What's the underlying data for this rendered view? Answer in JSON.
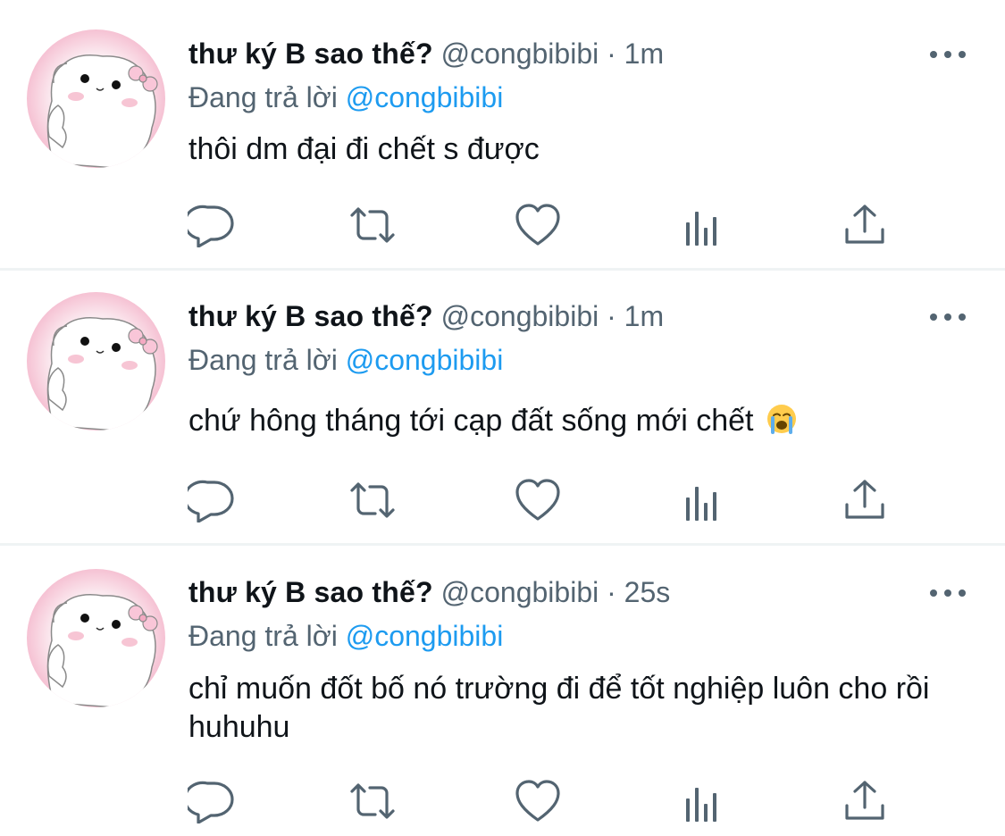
{
  "tweets": [
    {
      "name": "thư ký B sao thế?",
      "handle": "@congbibibi",
      "separator": "·",
      "time": "1m",
      "reply_prefix": "Đang trả lời",
      "reply_to": "@congbibibi",
      "text": "thôi dm đại đi chết s được"
    },
    {
      "name": "thư ký B sao thế?",
      "handle": "@congbibibi",
      "separator": "·",
      "time": "1m",
      "reply_prefix": "Đang trả lời",
      "reply_to": "@congbibibi",
      "text": "chứ hông tháng tới cạp đất sống mới chết",
      "emoji": "loudly-crying-face-icon"
    },
    {
      "name": "thư ký B sao thế?",
      "handle": "@congbibibi",
      "separator": "·",
      "time": "25s",
      "reply_prefix": "Đang trả lời",
      "reply_to": "@congbibibi",
      "text": "chỉ muốn đốt bố nó trường đi để tốt nghiệp luôn cho rồi huhuhu"
    }
  ],
  "colors": {
    "primary_text": "#0f1419",
    "secondary_text": "#536471",
    "link": "#1d9bf0",
    "divider": "#eff3f4"
  },
  "action_icons": [
    "reply-icon",
    "retweet-icon",
    "like-icon",
    "views-icon",
    "share-icon"
  ]
}
